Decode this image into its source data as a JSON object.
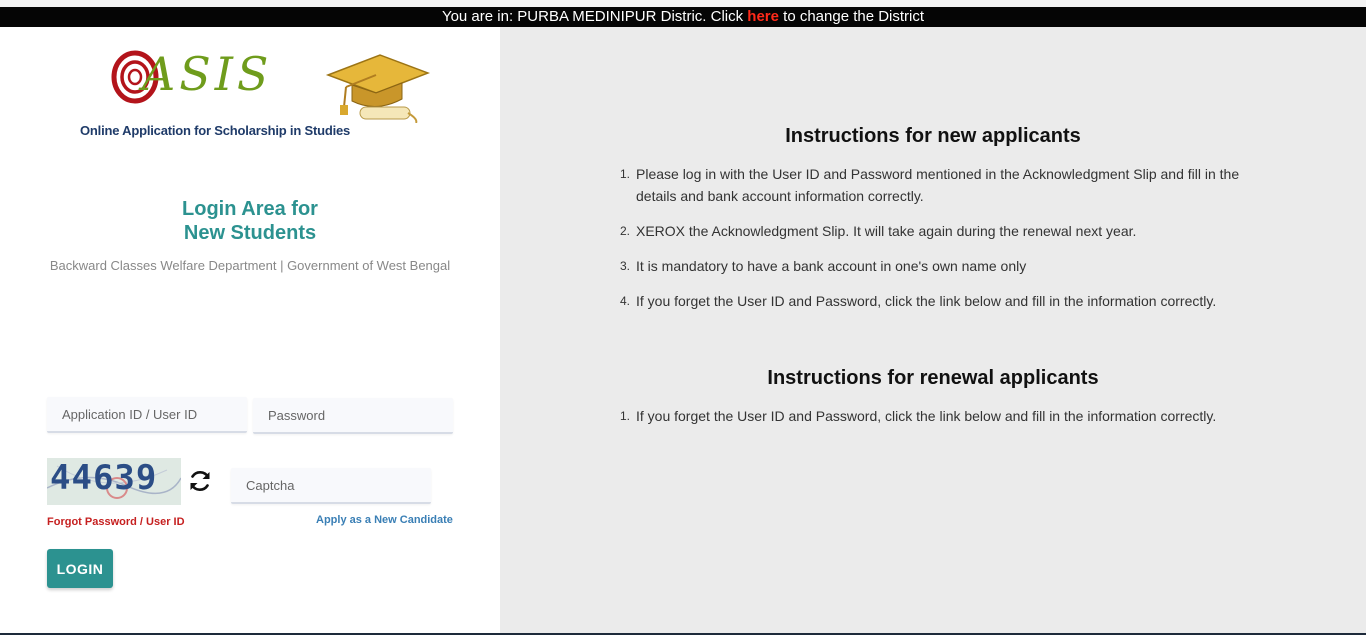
{
  "banner": {
    "prefix": "You are in: PURBA MEDINIPUR Distric. Click ",
    "link": "here",
    "suffix": " to change the District"
  },
  "logo": {
    "word": "ASIS",
    "tagline": "Online Application for Scholarship in Studies"
  },
  "login": {
    "title_line1": "Login Area for",
    "title_line2": "New Students",
    "subtitle": "Backward Classes Welfare Department | Government of West Bengal",
    "userid_placeholder": "Application ID / User ID",
    "password_placeholder": "Password",
    "captcha_image_text": "44639",
    "captcha_placeholder": "Captcha",
    "forgot_link": "Forgot Password / User ID",
    "apply_link": "Apply as a New Candidate",
    "login_button": "LOGIN"
  },
  "instructions": {
    "new_heading": "Instructions for new applicants",
    "new_items": [
      {
        "num": "1.",
        "text": "Please log in with the User ID and Password mentioned in the Acknowledgment Slip and fill in the details and bank account information correctly."
      },
      {
        "num": "2.",
        "text": "XEROX the Acknowledgment Slip. It will take again during the renewal next year."
      },
      {
        "num": "3.",
        "text": "It is mandatory to have a bank account in one's own name only"
      },
      {
        "num": "4.",
        "text": "If you forget the User ID and Password, click the link below and fill in the information correctly."
      }
    ],
    "renewal_heading": "Instructions for renewal applicants",
    "renewal_items": [
      {
        "num": "1.",
        "text": "If you forget the User ID and Password, click the link below and fill in the information correctly."
      }
    ]
  },
  "colors": {
    "accent_teal": "#2c9290",
    "link_red": "#c62020",
    "link_blue": "#3a7fb5",
    "banner_bg": "#050505",
    "right_panel_bg": "#ebebeb"
  },
  "icons": {
    "refresh": "refresh-icon",
    "logo_mark": "swirl-logo-icon",
    "graduation_cap": "graduation-cap-icon"
  }
}
